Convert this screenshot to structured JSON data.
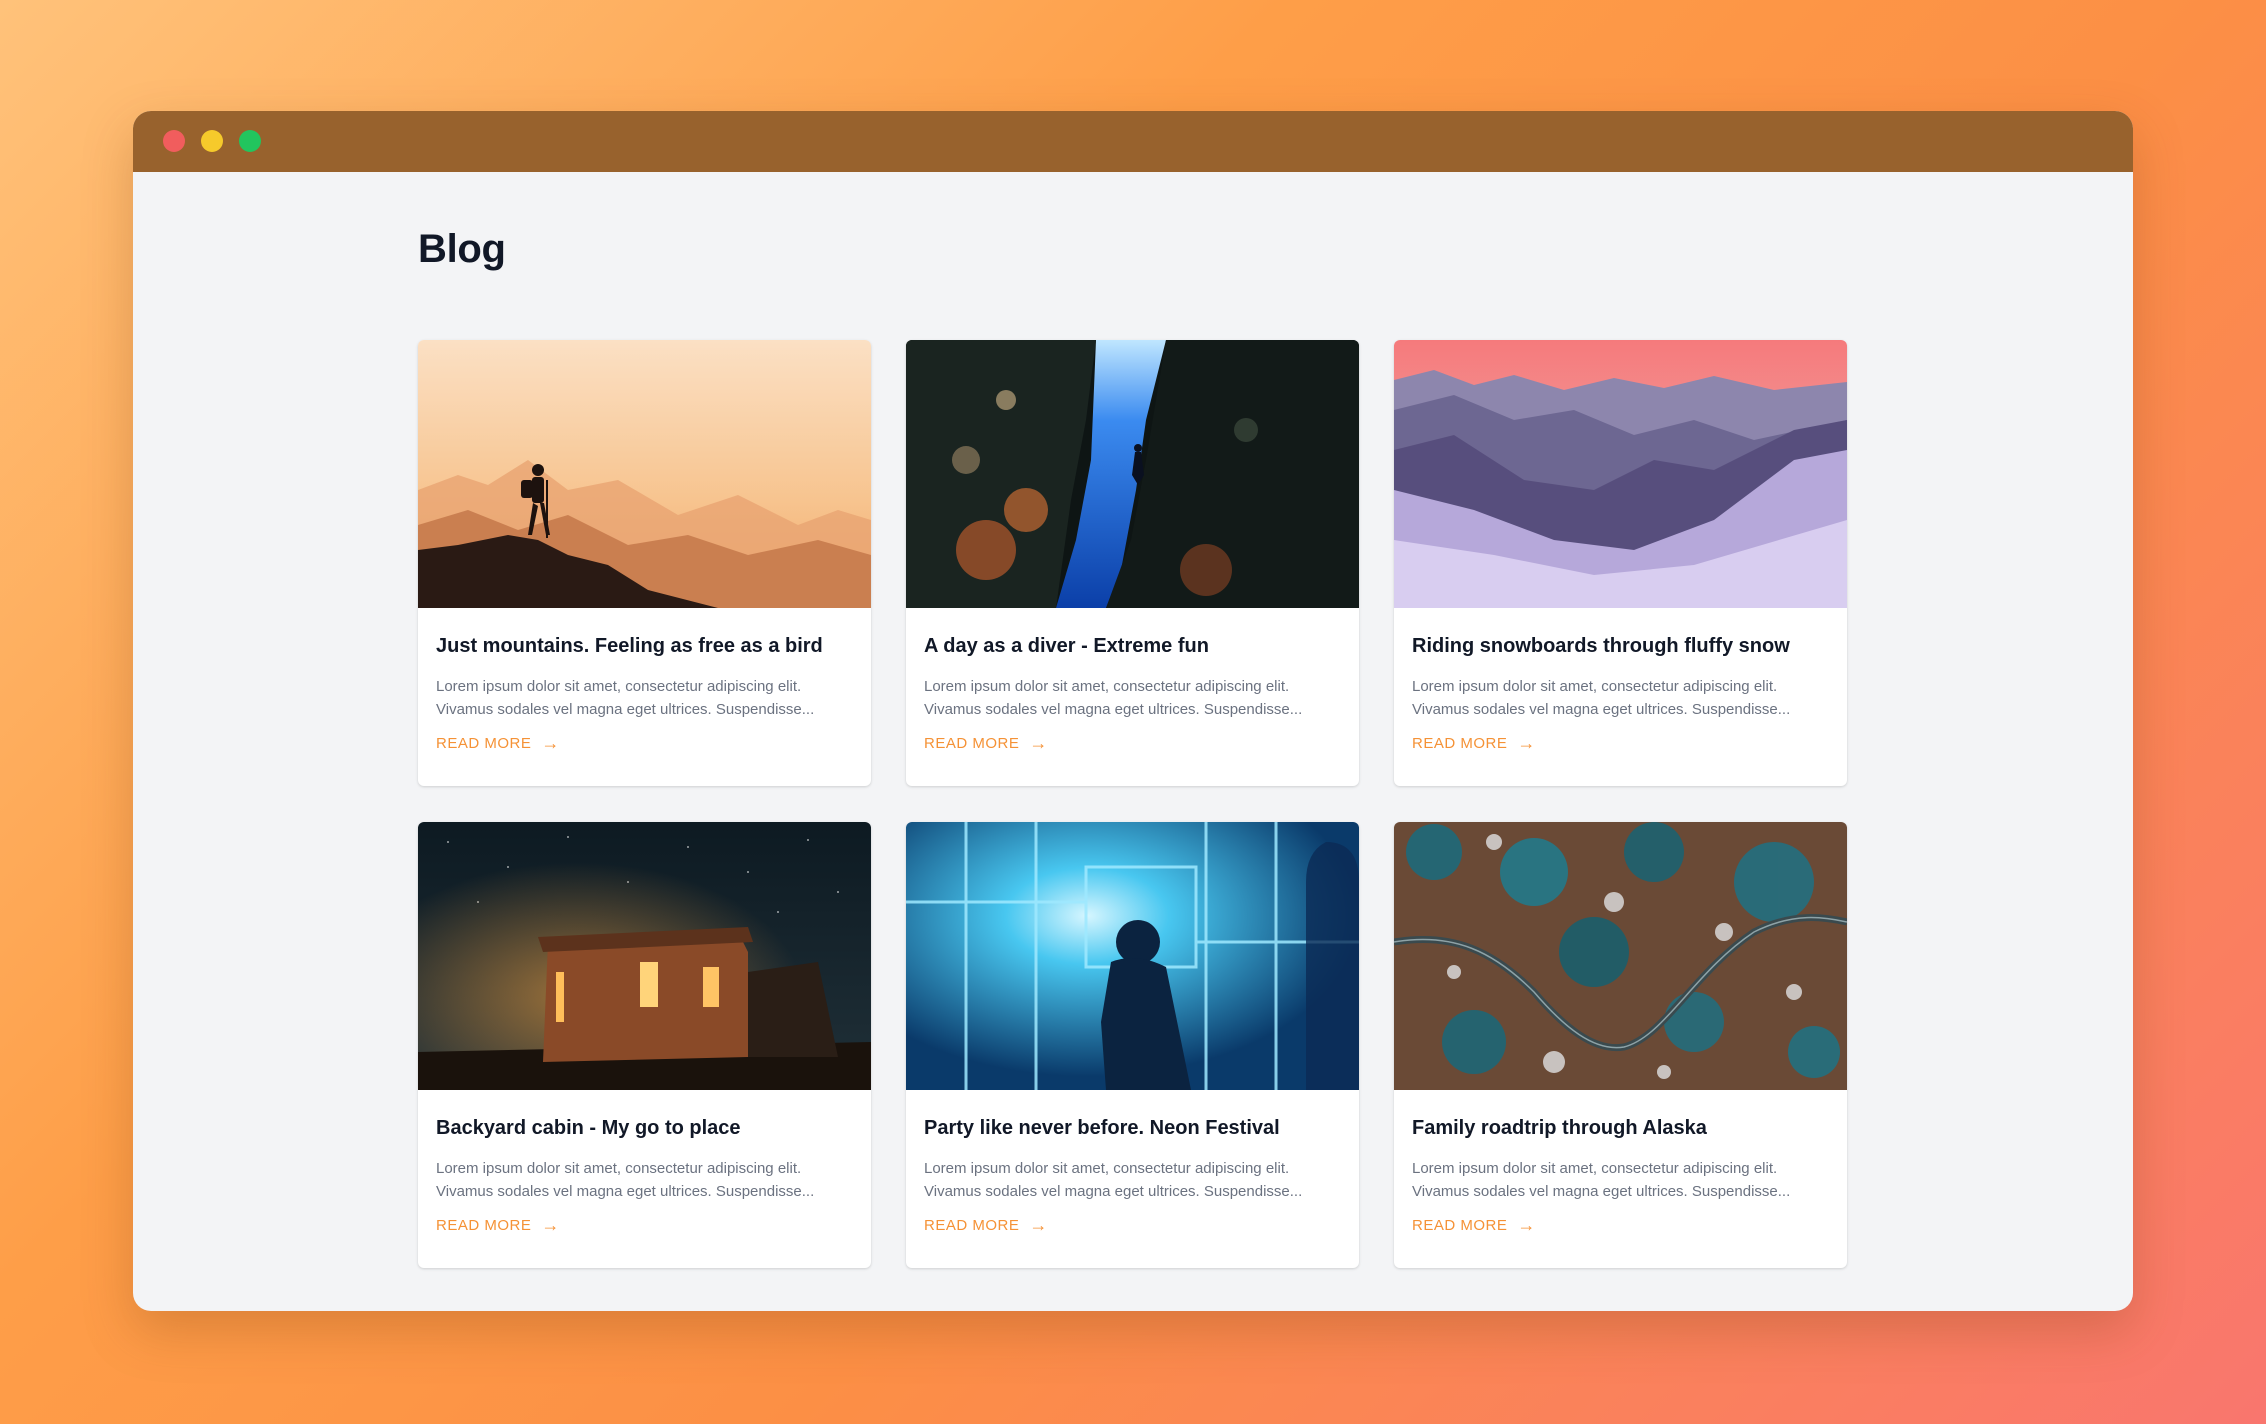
{
  "window": {
    "controls": [
      {
        "name": "close",
        "color": "#f15d5d"
      },
      {
        "name": "minimize",
        "color": "#f6ca2b"
      },
      {
        "name": "maximize",
        "color": "#22c55e"
      }
    ]
  },
  "page": {
    "title": "Blog"
  },
  "accent_color": "#f59236",
  "posts": [
    {
      "title": "Just mountains. Feeling as free as a bird",
      "excerpt": "Lorem ipsum dolor sit amet, consectetur adipiscing elit. Vivamus sodales vel magna eget ultrices. Suspendisse...",
      "read_more": "READ MORE",
      "arrow": "→",
      "image": "hiker-on-mountain-at-sunset"
    },
    {
      "title": "A day as a diver - Extreme fun",
      "excerpt": "Lorem ipsum dolor sit amet, consectetur adipiscing elit. Vivamus sodales vel magna eget ultrices. Suspendisse...",
      "read_more": "READ MORE",
      "arrow": "→",
      "image": "diver-in-underwater-canyon"
    },
    {
      "title": "Riding snowboards through fluffy snow",
      "excerpt": "Lorem ipsum dolor sit amet, consectetur adipiscing elit. Vivamus sodales vel magna eget ultrices. Suspendisse...",
      "read_more": "READ MORE",
      "arrow": "→",
      "image": "snowy-mountain-valley-at-dusk"
    },
    {
      "title": "Backyard cabin - My go to place",
      "excerpt": "Lorem ipsum dolor sit amet, consectetur adipiscing elit. Vivamus sodales vel magna eget ultrices. Suspendisse...",
      "read_more": "READ MORE",
      "arrow": "→",
      "image": "adobe-cabin-under-night-sky"
    },
    {
      "title": "Party like never before. Neon Festival",
      "excerpt": "Lorem ipsum dolor sit amet, consectetur adipiscing elit. Vivamus sodales vel magna eget ultrices. Suspendisse...",
      "read_more": "READ MORE",
      "arrow": "→",
      "image": "silhouette-in-neon-glass-room"
    },
    {
      "title": "Family roadtrip through Alaska",
      "excerpt": "Lorem ipsum dolor sit amet, consectetur adipiscing elit. Vivamus sodales vel magna eget ultrices. Suspendisse...",
      "read_more": "READ MORE",
      "arrow": "→",
      "image": "aerial-winding-road-through-forest"
    }
  ]
}
